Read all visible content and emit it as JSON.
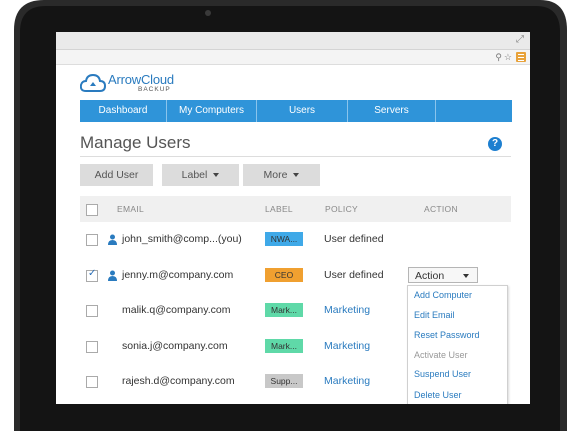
{
  "brand": {
    "name": "ArrowCloud",
    "tagline": "BACKUP",
    "accent": "#2f94d9"
  },
  "nav": {
    "tabs": [
      "Dashboard",
      "My Computers",
      "Users",
      "Servers",
      ""
    ]
  },
  "page": {
    "title": "Manage Users",
    "help_icon": "?"
  },
  "toolbar": {
    "add_user": "Add User",
    "label": "Label",
    "more": "More"
  },
  "table": {
    "headers": {
      "email": "EMAIL",
      "label": "LABEL",
      "policy": "POLICY",
      "action": "ACTION"
    },
    "rows": [
      {
        "email": "john_smith@comp...(you)",
        "label": "NWA...",
        "label_color": "#3fa9e8",
        "policy": "User defined",
        "checked": false,
        "user_icon": true
      },
      {
        "email": "jenny.m@company.com",
        "label": "CEO",
        "label_color": "#f0a030",
        "policy": "User defined",
        "checked": true,
        "user_icon": true
      },
      {
        "email": "malik.q@company.com",
        "label": "Mark...",
        "label_color": "#5fd9a8",
        "policy": "Marketing",
        "checked": false,
        "user_icon": false
      },
      {
        "email": "sonia.j@company.com",
        "label": "Mark...",
        "label_color": "#5fd9a8",
        "policy": "Marketing",
        "checked": false,
        "user_icon": false
      },
      {
        "email": "rajesh.d@company.com",
        "label": "Supp...",
        "label_color": "#c8c8c8",
        "policy": "Marketing",
        "checked": false,
        "user_icon": false
      }
    ]
  },
  "action_menu": {
    "button": "Action",
    "items": [
      {
        "label": "Add Computer",
        "enabled": true
      },
      {
        "label": "Edit Email",
        "enabled": true
      },
      {
        "label": "Reset Password",
        "enabled": true
      },
      {
        "label": "Activate User",
        "enabled": false
      },
      {
        "label": "Suspend User",
        "enabled": true
      },
      {
        "label": "Delete User",
        "enabled": true
      }
    ]
  }
}
